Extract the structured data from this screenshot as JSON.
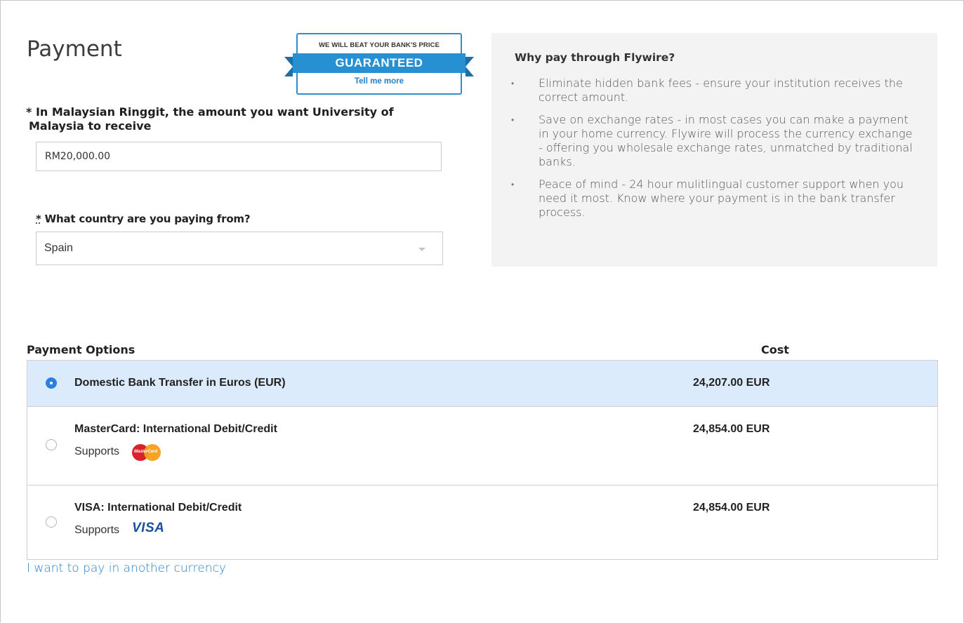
{
  "page_title": "Payment",
  "badge": {
    "top_text": "WE WILL BEAT YOUR BANK'S PRICE",
    "ribbon_text": "GUARANTEED",
    "link_text": "Tell me more"
  },
  "amount": {
    "label_line1": "* In Malaysian Ringgit, the amount you want University of",
    "label_line2": "Malaysia to receive",
    "value": "RM20,000.00"
  },
  "country": {
    "required_mark": "*",
    "label": " What country are you paying from?",
    "selected": "Spain"
  },
  "info": {
    "title": "Why pay through Flywire?",
    "bullet_glyph": "•",
    "bullets": [
      "Eliminate hidden bank fees - ensure your institution receives the correct amount.",
      "Save on exchange rates - in most cases you can make a payment in your home currency. Flywire will process the currency exchange - offering you wholesale exchange rates, unmatched by traditional banks.",
      "Peace of mind - 24 hour mulitlingual customer support when you need it most. Know where your payment is in the bank transfer process."
    ]
  },
  "payment_options": {
    "header": "Payment Options",
    "cost_header": "Cost",
    "supports_label": "Supports",
    "mastercard_logo_text": "MasterCard",
    "visa_logo_text": "VISA",
    "options": [
      {
        "name": "Domestic Bank Transfer in Euros (EUR)",
        "cost": "24,207.00 EUR",
        "selected": true
      },
      {
        "name": "MasterCard: International Debit/Credit",
        "cost": "24,854.00 EUR",
        "selected": false
      },
      {
        "name": "VISA: International Debit/Credit",
        "cost": "24,854.00 EUR",
        "selected": false
      }
    ]
  },
  "other_currency_link": "I want to pay in another currency",
  "colors": {
    "accent_blue": "#2690d3",
    "selected_row_bg": "#dcebfb",
    "link_blue": "#2380c6",
    "panel_bg": "#f3f3f3"
  }
}
